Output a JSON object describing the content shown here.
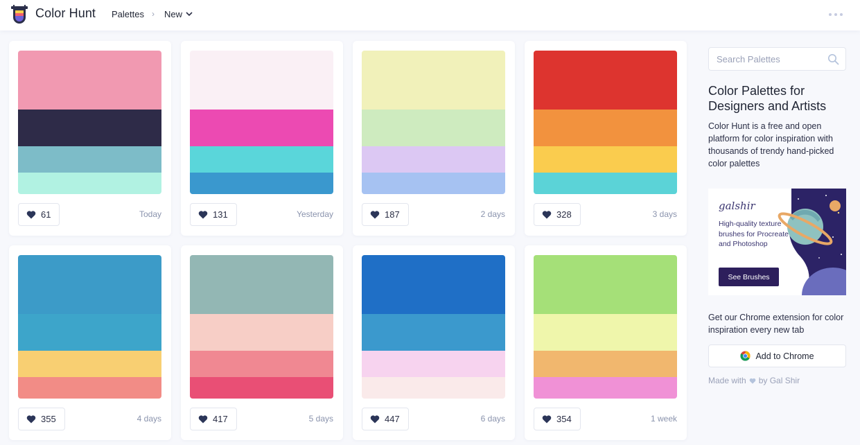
{
  "header": {
    "brand": "Color Hunt",
    "nav_palettes": "Palettes",
    "nav_separator": "›",
    "nav_new": "New",
    "logo_icon": "color-hunt-logo-icon",
    "more_icon": "more-dots-icon"
  },
  "palettes": [
    {
      "colors": [
        "#F199B1",
        "#2E2B48",
        "#7DBCC8",
        "#B1F2E2"
      ],
      "likes": "61",
      "date": "Today"
    },
    {
      "colors": [
        "#FAF0F5",
        "#EC4AB2",
        "#5AD6DA",
        "#3A98CE"
      ],
      "likes": "131",
      "date": "Yesterday"
    },
    {
      "colors": [
        "#F1F1BA",
        "#CEEBBF",
        "#DCC8F3",
        "#A6C2F2"
      ],
      "likes": "187",
      "date": "2 days"
    },
    {
      "colors": [
        "#DD342F",
        "#F2923E",
        "#FACC4E",
        "#5BD3D7"
      ],
      "likes": "328",
      "date": "3 days"
    },
    {
      "colors": [
        "#3C9BC8",
        "#3DA5CA",
        "#F8CF72",
        "#F28C86"
      ],
      "likes": "355",
      "date": "4 days"
    },
    {
      "colors": [
        "#93B7B4",
        "#F7CEC6",
        "#F08892",
        "#E94F75"
      ],
      "likes": "417",
      "date": "5 days"
    },
    {
      "colors": [
        "#1F6FC6",
        "#3B99CD",
        "#F7D3EF",
        "#FAEAEA"
      ],
      "likes": "447",
      "date": "6 days"
    },
    {
      "colors": [
        "#A5E078",
        "#EFF6AB",
        "#F1B76E",
        "#F091D6"
      ],
      "likes": "354",
      "date": "1 week"
    }
  ],
  "sidebar": {
    "search_placeholder": "Search Palettes",
    "title": "Color Palettes for Designers and Artists",
    "description": "Color Hunt is a free and open platform for color inspiration with thousands of trendy hand-picked color palettes",
    "ad": {
      "brand": "galshir",
      "text": "High-quality texture brushes for Procreate and Photoshop",
      "button": "See Brushes"
    },
    "extension_text": "Get our Chrome extension for color inspiration every new tab",
    "chrome_button": "Add to Chrome",
    "made_with_prefix": "Made with",
    "made_with_suffix": "by Gal Shir"
  }
}
